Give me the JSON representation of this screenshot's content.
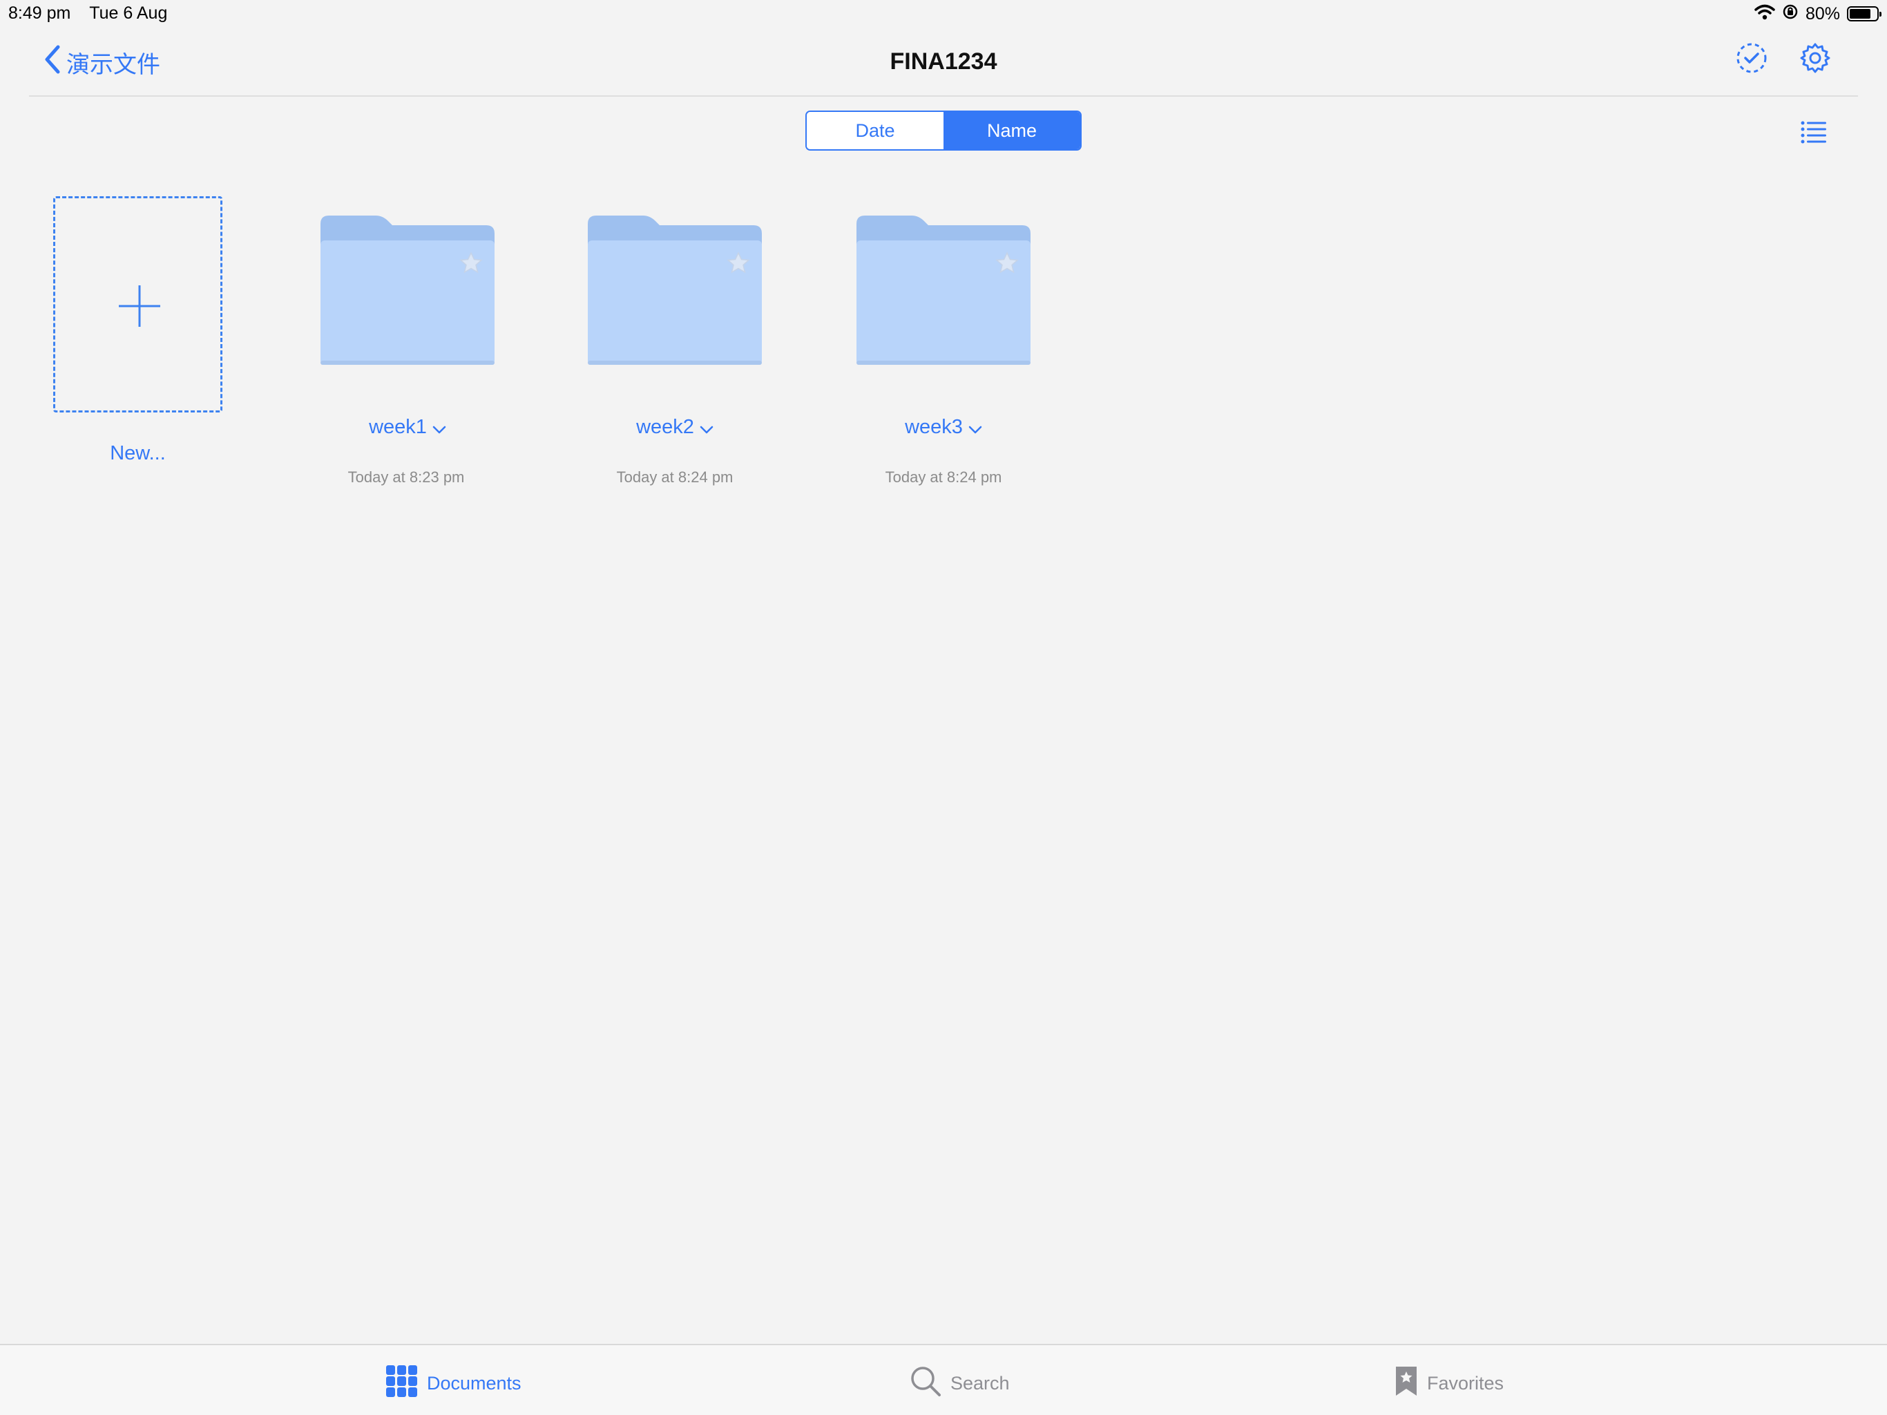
{
  "status_bar": {
    "time": "8:49 pm",
    "date": "Tue 6 Aug",
    "battery_percent": "80%",
    "battery_level": 0.8,
    "icons": [
      "wifi-icon",
      "orientation-lock-icon",
      "battery-icon"
    ]
  },
  "nav": {
    "back_label": "演示文件",
    "title": "FINA1234",
    "icons": [
      "select-icon",
      "settings-icon"
    ]
  },
  "sort": {
    "options": [
      "Date",
      "Name"
    ],
    "selected": "Name"
  },
  "new_item": {
    "label": "New..."
  },
  "folders": [
    {
      "name": "week1",
      "date": "Today at 8:23 pm"
    },
    {
      "name": "week2",
      "date": "Today at 8:24 pm"
    },
    {
      "name": "week3",
      "date": "Today at 8:24 pm"
    }
  ],
  "tab_bar": {
    "tabs": [
      {
        "label": "Documents",
        "icon": "documents-grid-icon",
        "active": true
      },
      {
        "label": "Search",
        "icon": "search-icon",
        "active": false
      },
      {
        "label": "Favorites",
        "icon": "favorites-bookmark-icon",
        "active": false
      }
    ]
  },
  "colors": {
    "accent": "#3478f6",
    "folder_front": "#b8d4fa",
    "folder_back": "#9ec0ef",
    "background": "#f3f3f3"
  }
}
